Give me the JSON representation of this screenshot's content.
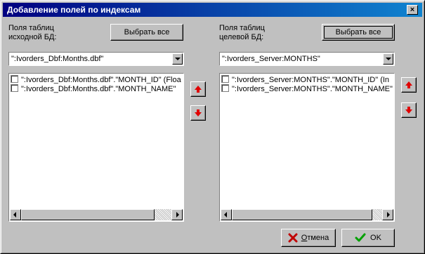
{
  "window": {
    "title": "Добавление полей по индексам",
    "close_label": "×"
  },
  "source": {
    "label": "Поля таблиц\nисходной БД:",
    "select_all_label": "Выбрать все",
    "combo_value": "\":Ivorders_Dbf:Months.dbf\"",
    "items": [
      "\":Ivorders_Dbf:Months.dbf\".\"MONTH_ID\"   (Floa",
      "\":Ivorders_Dbf:Months.dbf\".\"MONTH_NAME\""
    ]
  },
  "target": {
    "label": "Поля таблиц\nцелевой БД:",
    "select_all_label": "Выбрать все",
    "combo_value": "\":Ivorders_Server:MONTHS\"",
    "items": [
      "\":Ivorders_Server:MONTHS\".\"MONTH_ID\"   (In",
      "\":Ivorders_Server:MONTHS\".\"MONTH_NAME\""
    ]
  },
  "footer": {
    "cancel_label": "Отмена",
    "cancel_mnemonic": "О",
    "cancel_rest": "тмена",
    "ok_label": "OK"
  },
  "colors": {
    "titlebar": "#000080",
    "accent_red": "#e00000",
    "ok_green": "#00a000",
    "face": "#c0c0c0"
  }
}
